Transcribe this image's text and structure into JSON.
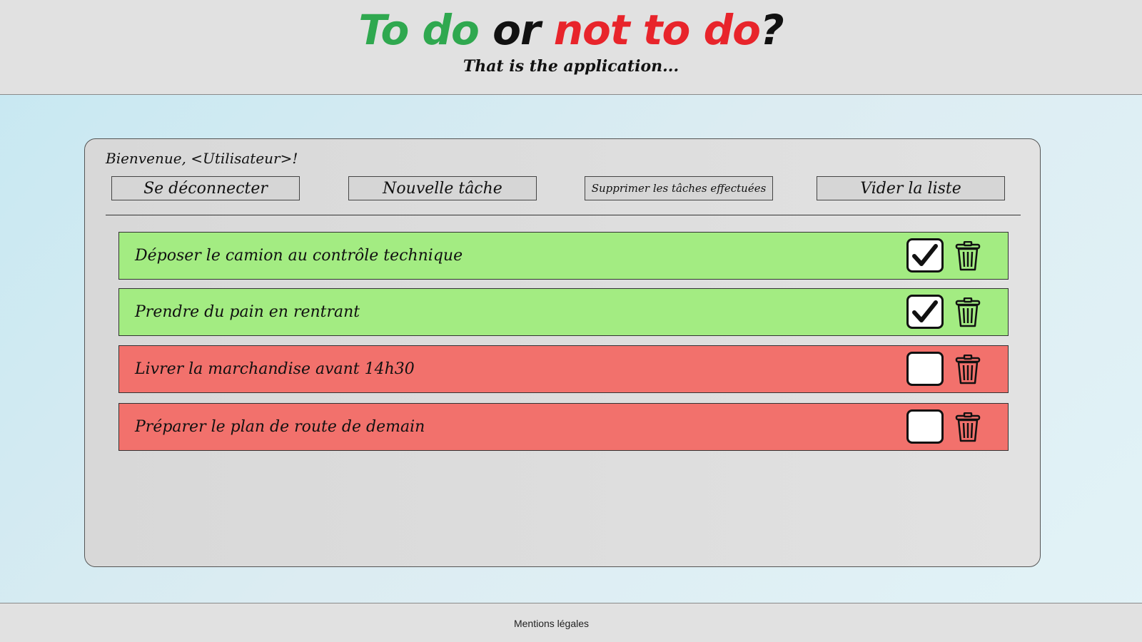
{
  "header": {
    "logo": {
      "part1": "To do",
      "part2": "or",
      "part3": "not to do",
      "part4": "?"
    },
    "tagline": "That is the application..."
  },
  "panel": {
    "welcome": "Bienvenue, <Utilisateur>!",
    "buttons": {
      "logout": "Se déconnecter",
      "new_task": "Nouvelle tâche",
      "delete_done": "Supprimer les tâches effectuées",
      "clear_list": "Vider la liste"
    },
    "tasks": [
      {
        "label": "Déposer le camion au contrôle technique",
        "done": true
      },
      {
        "label": "Prendre du pain en rentrant",
        "done": true
      },
      {
        "label": "Livrer la marchandise avant 14h30",
        "done": false
      },
      {
        "label": "Préparer le plan de route de demain",
        "done": false
      }
    ]
  },
  "footer": {
    "link": "Mentions légales"
  },
  "colors": {
    "done": "#a3ec82",
    "todo": "#f2716c",
    "logo_green": "#2fa84f",
    "logo_red": "#e8242b"
  },
  "icons": {
    "check": "checkmark-icon",
    "delete": "trash-icon"
  }
}
